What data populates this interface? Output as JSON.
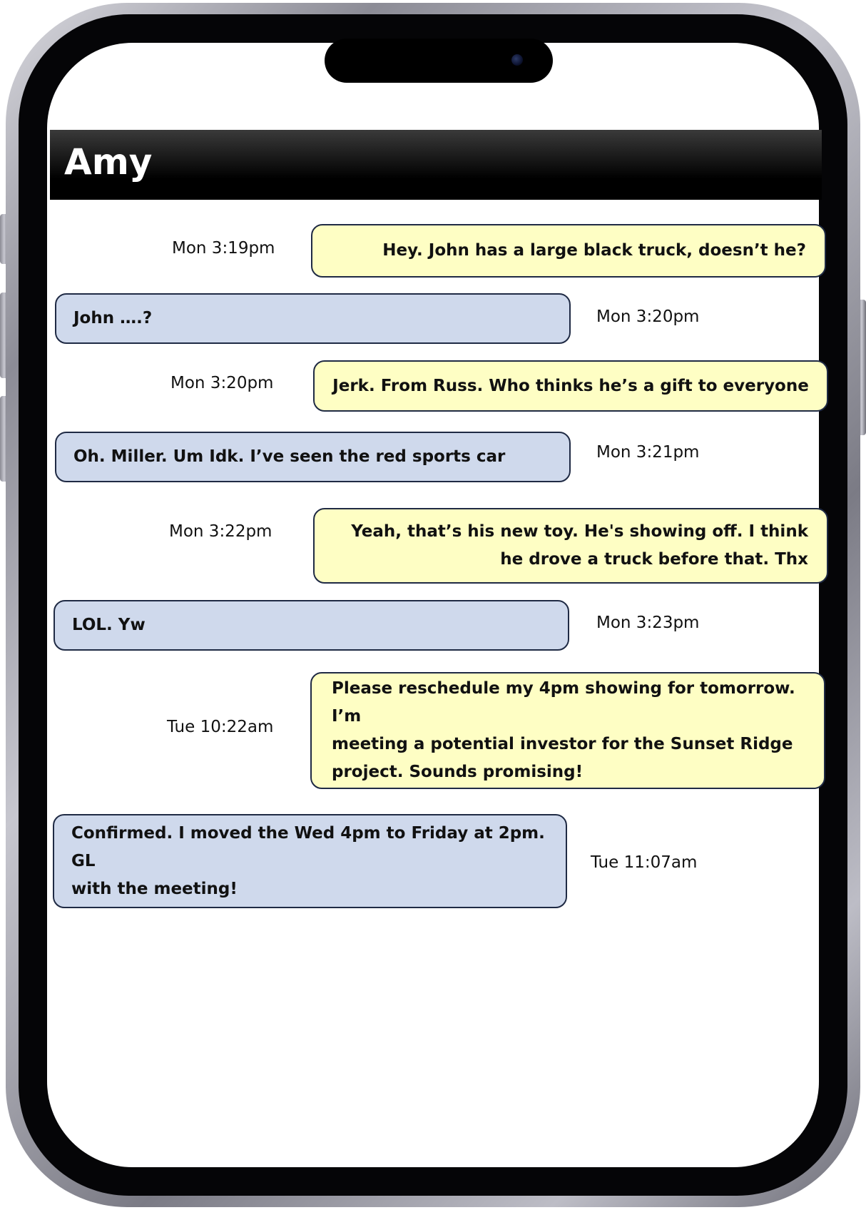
{
  "contact": {
    "name": "Amy"
  },
  "messages": [
    {
      "direction": "sent",
      "text": "Hey. John has a large black truck, doesn’t he?",
      "time": "Mon 3:19pm"
    },
    {
      "direction": "received",
      "text": "John ….?",
      "time": "Mon 3:20pm"
    },
    {
      "direction": "sent",
      "text": "Jerk. From Russ. Who thinks he’s a gift to everyone",
      "time": "Mon 3:20pm"
    },
    {
      "direction": "received",
      "text": "Oh. Miller. Um Idk. I’ve seen the red sports car",
      "time": "Mon 3:21pm"
    },
    {
      "direction": "sent",
      "text_lines": [
        "Yeah, that’s his new toy. He's showing off. I think",
        "he drove a truck before that. Thx"
      ],
      "time": "Mon 3:22pm"
    },
    {
      "direction": "received",
      "text": "LOL. Yw",
      "time": "Mon 3:23pm"
    },
    {
      "direction": "sent",
      "text_lines": [
        "Please reschedule my 4pm showing for tomorrow. I’m",
        "meeting a potential investor for the Sunset Ridge",
        "project. Sounds promising!"
      ],
      "time": "Tue 10:22am"
    },
    {
      "direction": "received",
      "text_lines": [
        "Confirmed. I moved the Wed 4pm to Friday at 2pm. GL",
        "with the meeting!"
      ],
      "time": "Tue 11:07am"
    }
  ],
  "colors": {
    "sent_bubble": "#fefec4",
    "received_bubble": "#cfd9ec",
    "bubble_border": "#1f2a44",
    "header_background": "#000000",
    "header_text": "#ffffff"
  }
}
